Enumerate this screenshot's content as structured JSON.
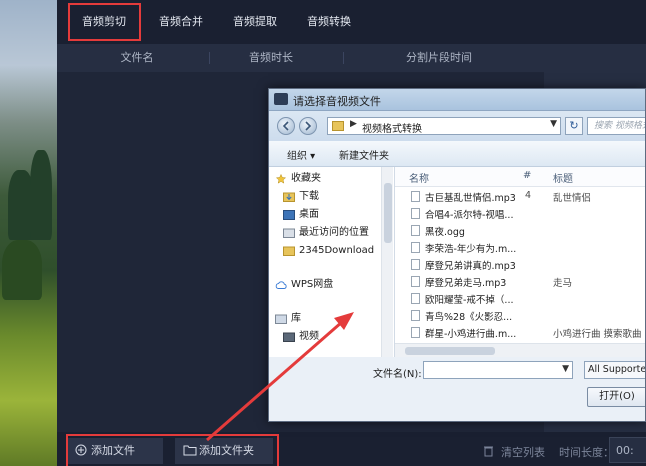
{
  "tabs": [
    {
      "label": "音频剪切",
      "active": true
    },
    {
      "label": "音频合并"
    },
    {
      "label": "音频提取"
    },
    {
      "label": "音频转换"
    }
  ],
  "columns": [
    "文件名",
    "音频时长",
    "分割片段时间"
  ],
  "bottom": {
    "add_file": "添加文件",
    "add_folder": "添加文件夹",
    "clear_list": "清空列表",
    "duration_label": "时间长度：",
    "duration_value": "00:"
  },
  "dialog": {
    "title": "请选择音视频文件",
    "address": "视频格式转换",
    "search_placeholder": "搜索 视频格式转",
    "refresh_glyph": "↻",
    "organize": "组织 ▾",
    "new_folder": "新建文件夹",
    "nav_items": [
      {
        "label": "收藏夹",
        "icon": "star-icon"
      },
      {
        "label": "下载",
        "icon": "download-folder-icon"
      },
      {
        "label": "桌面",
        "icon": "desktop-icon"
      },
      {
        "label": "最近访问的位置",
        "icon": "recent-places-icon"
      },
      {
        "label": "2345Download",
        "icon": "folder-icon"
      },
      {
        "label": "WPS网盘",
        "icon": "cloud-icon"
      },
      {
        "label": "库",
        "icon": "library-icon"
      },
      {
        "label": "视频",
        "icon": "video-library-icon"
      }
    ],
    "file_columns": {
      "name": "名称",
      "number": "#",
      "title": "标题"
    },
    "files": [
      {
        "name": "古巨基乱世情侣.mp3",
        "number": "4",
        "title": "乱世情侣"
      },
      {
        "name": "合唱4-派尔特-视唱...",
        "number": "",
        "title": ""
      },
      {
        "name": "黑夜.ogg",
        "number": "",
        "title": ""
      },
      {
        "name": "李荣浩-年少有为.m...",
        "number": "",
        "title": ""
      },
      {
        "name": "摩登兄弟讲真的.mp3",
        "number": "",
        "title": ""
      },
      {
        "name": "摩登兄弟走马.mp3",
        "number": "",
        "title": "走马"
      },
      {
        "name": "欧阳耀莹-戒不掉（...",
        "number": "",
        "title": ""
      },
      {
        "name": "青鸟%28《火影忍...",
        "number": "",
        "title": ""
      },
      {
        "name": "群星-小鸡进行曲.m...",
        "number": "",
        "title": "小鸡进行曲 摸索歌曲"
      }
    ],
    "filename_label": "文件名(N):",
    "filename_value": "",
    "file_type": "All Supported",
    "open_button": "打开(O)"
  },
  "colors": {
    "highlight_box": "#e43b3b",
    "app_bg": "#1f2638",
    "dialog_bg": "#eaf0f7"
  }
}
